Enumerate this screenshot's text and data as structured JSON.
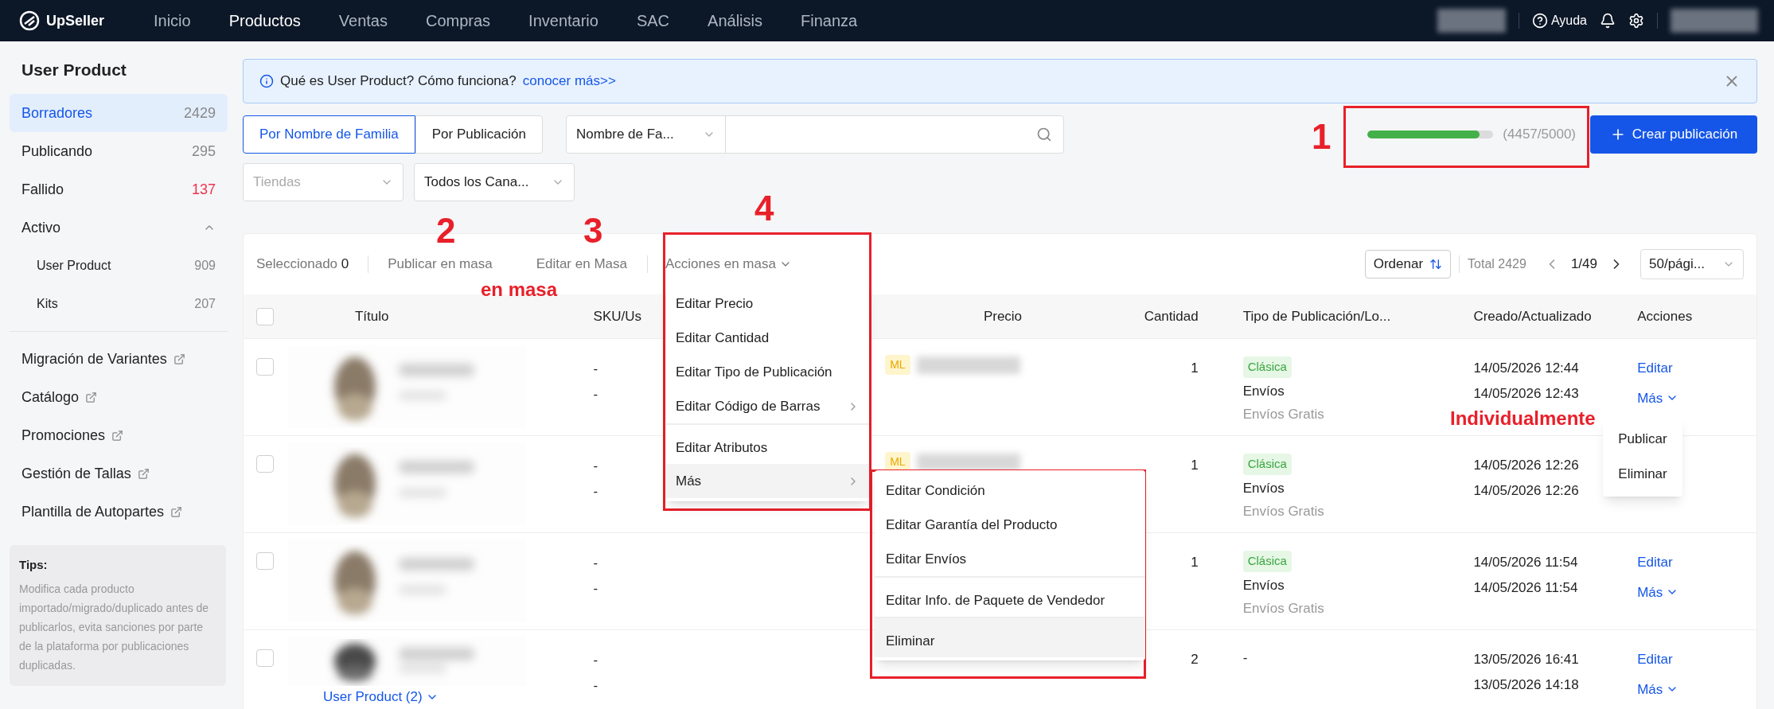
{
  "topbar": {
    "logo": "UpSeller",
    "nav": [
      {
        "label": "Inicio",
        "selected": false
      },
      {
        "label": "Productos",
        "selected": true
      },
      {
        "label": "Ventas",
        "selected": false
      },
      {
        "label": "Compras",
        "selected": false
      },
      {
        "label": "Inventario",
        "selected": false
      },
      {
        "label": "SAC",
        "selected": false
      },
      {
        "label": "Análisis",
        "selected": false
      },
      {
        "label": "Finanza",
        "selected": false
      }
    ],
    "help": "Ayuda"
  },
  "sidebar": {
    "title": "User Product",
    "items": [
      {
        "label": "Borradores",
        "count": "2429",
        "selected": true,
        "alert": false
      },
      {
        "label": "Publicando",
        "count": "295",
        "selected": false,
        "alert": false
      },
      {
        "label": "Fallido",
        "count": "137",
        "selected": false,
        "alert": true
      },
      {
        "label": "Activo",
        "expanded": true,
        "selected": false,
        "children": [
          {
            "label": "User Product",
            "count": "909",
            "selected": false
          },
          {
            "label": "Kits",
            "count": "207",
            "selected": false
          }
        ]
      }
    ],
    "links": [
      "Migración de Variantes",
      "Catálogo",
      "Promociones",
      "Gestión de Tallas",
      "Plantilla de Autopartes"
    ],
    "tips": {
      "title": "Tips:",
      "text": "Modifica cada producto importado/migrado/duplicado antes de publicarlos, evita sanciones por parte de la plataforma por publicaciones duplicadas."
    }
  },
  "banner": {
    "text": "Qué es User Product? Cómo funciona?",
    "link": "conocer más>>"
  },
  "view_tabs": [
    {
      "label": "Por Nombre de Familia",
      "selected": true
    },
    {
      "label": "Por Publicación",
      "selected": false
    }
  ],
  "search": {
    "field_select": "Nombre de Fa..."
  },
  "quota": {
    "level": 0.8914,
    "reading": "(4457/5000)"
  },
  "create_button": "Crear publicación",
  "filters": [
    {
      "label": "Tiendas",
      "placeholder": true
    },
    {
      "label": "Todos los Cana...",
      "placeholder": false
    }
  ],
  "toolbar": {
    "selected_label": "Seleccionado",
    "selected_count": "0",
    "actions": [
      "Publicar en masa",
      "Editar en Masa",
      "Acciones en masa"
    ],
    "sort": "Ordenar",
    "total": "Total 2429",
    "page": "1/49",
    "page_size": "50/pági..."
  },
  "table": {
    "columns": [
      "Título",
      "SKU/Us",
      "Precio",
      "Cantidad",
      "Tipo de Publicación/Lo...",
      "Creado/Actualizado",
      "Acciones"
    ],
    "rows": [
      {
        "checked": false,
        "sku": [
          "-",
          "-"
        ],
        "badge": "ML",
        "quantity": "1",
        "tag": "Clásica",
        "type": "Envíos",
        "shipping": "Envíos Gratis",
        "created": "14/05/2026 12:44",
        "updated": "14/05/2026 12:43",
        "actions": [
          "Editar",
          "Más"
        ]
      },
      {
        "checked": false,
        "sku": [
          "-",
          "-"
        ],
        "badge": "ML",
        "quantity": "1",
        "tag": "Clásica",
        "type": "Envíos",
        "shipping": "Envíos Gratis",
        "created": "14/05/2026 12:26",
        "updated": "14/05/2026 12:26",
        "actions": []
      },
      {
        "checked": false,
        "sku": [
          "-",
          "-"
        ],
        "quantity": "1",
        "tag": "Clásica",
        "type": "Envíos",
        "shipping": "Envíos Gratis",
        "created": "14/05/2026 11:54",
        "updated": "14/05/2026 11:54",
        "actions": [
          "Editar",
          "Más"
        ]
      },
      {
        "checked": false,
        "sku": [
          "-",
          "-"
        ],
        "quantity": "2",
        "type": "-",
        "created": "13/05/2026 16:41",
        "updated": "13/05/2026 14:18",
        "actions": [
          "Editar",
          "Más"
        ],
        "group_link": "User Product (2)"
      }
    ]
  },
  "bulk_menu": [
    {
      "label": "Editar Precio",
      "submenu": false,
      "divider_before": false,
      "highlighted": false
    },
    {
      "label": "Editar Cantidad",
      "submenu": false,
      "divider_before": false,
      "highlighted": false
    },
    {
      "label": "Editar Tipo de Publicación",
      "submenu": false,
      "divider_before": false,
      "highlighted": false
    },
    {
      "label": "Editar Código de Barras",
      "submenu": true,
      "divider_before": false,
      "highlighted": false
    },
    {
      "label": "Editar Atributos",
      "submenu": false,
      "divider_before": true,
      "highlighted": false
    },
    {
      "label": "Más",
      "submenu": true,
      "divider_before": false,
      "highlighted": true
    }
  ],
  "more_submenu": [
    {
      "label": "Editar Condición",
      "divider_before": false,
      "highlighted": false
    },
    {
      "label": "Editar Garantía del Producto",
      "divider_before": false,
      "highlighted": false
    },
    {
      "label": "Editar Envíos",
      "divider_before": false,
      "highlighted": false
    },
    {
      "label": "Editar Info. de Paquete de Vendedor",
      "divider_before": true,
      "highlighted": false
    },
    {
      "label": "Eliminar",
      "divider_before": true,
      "highlighted": true
    }
  ],
  "row_menu": [
    "Publicar",
    "Eliminar"
  ],
  "annotations": [
    {
      "kind": "number",
      "text": "1"
    },
    {
      "kind": "number",
      "text": "2"
    },
    {
      "kind": "number",
      "text": "3"
    },
    {
      "kind": "number",
      "text": "4"
    },
    {
      "kind": "label",
      "text": "en masa"
    },
    {
      "kind": "label",
      "text": "Individualmente"
    },
    {
      "kind": "frame"
    },
    {
      "kind": "frame"
    },
    {
      "kind": "frame"
    }
  ]
}
